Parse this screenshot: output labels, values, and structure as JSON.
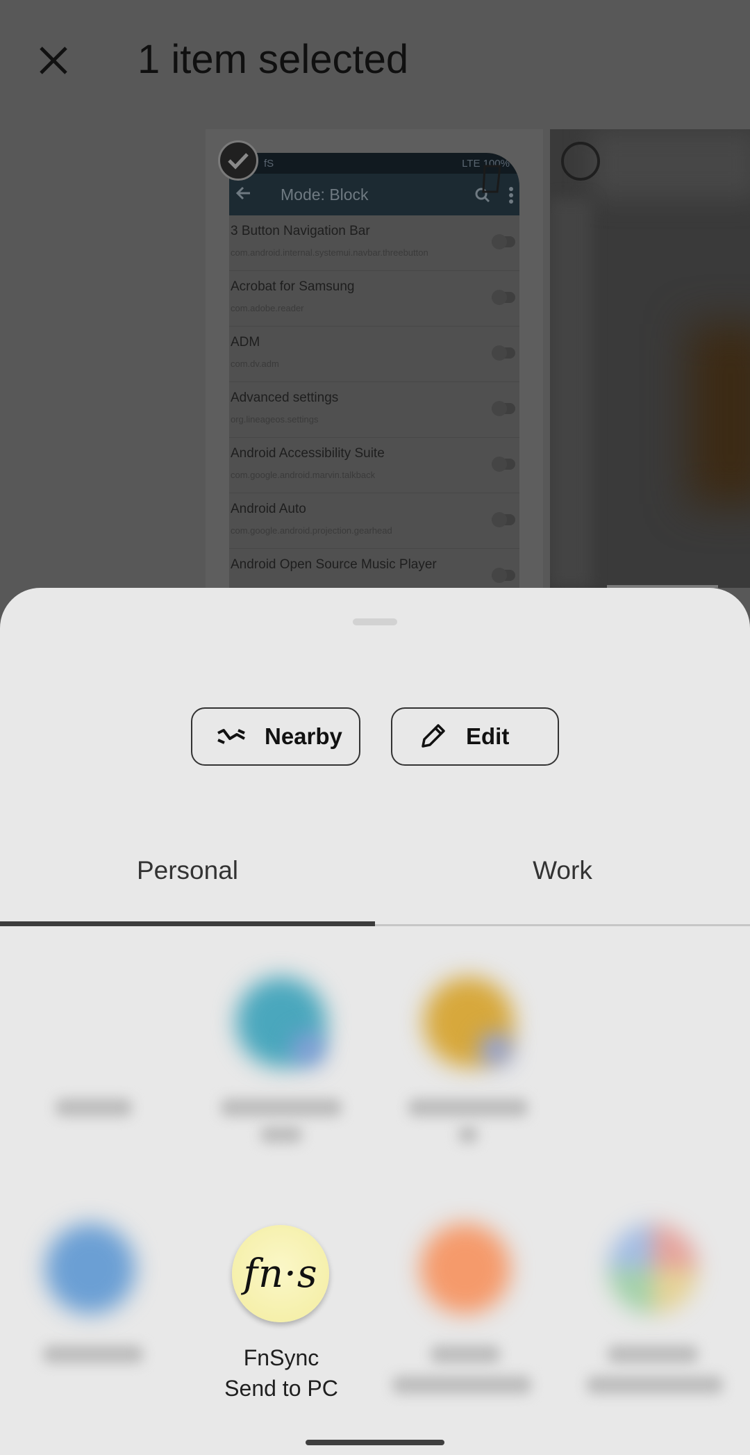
{
  "topbar": {
    "title": "1 item selected",
    "close_icon": "close-icon"
  },
  "preview": {
    "status_left": "fS",
    "status_right": "LTE 100%",
    "appbar_title": "Mode: Block",
    "apps": [
      {
        "name": "3 Button Navigation Bar",
        "package": "com.android.internal.systemui.navbar.threebutton"
      },
      {
        "name": "Acrobat for Samsung",
        "package": "com.adobe.reader"
      },
      {
        "name": "ADM",
        "package": "com.dv.adm"
      },
      {
        "name": "Advanced settings",
        "package": "org.lineageos.settings"
      },
      {
        "name": "Android Accessibility Suite",
        "package": "com.google.android.marvin.talkback"
      },
      {
        "name": "Android Auto",
        "package": "com.google.android.projection.gearhead"
      },
      {
        "name": "Android Open Source Music Player",
        "package": ""
      }
    ]
  },
  "actions": {
    "nearby_label": "Nearby",
    "edit_label": "Edit"
  },
  "tabs": {
    "personal": "Personal",
    "work": "Work"
  },
  "share_target": {
    "logo_text": "fn·s",
    "name": "FnSync",
    "subtitle": "Send to PC"
  },
  "colors": {
    "sheet_bg": "#e8e8e8",
    "scrim": "#585858",
    "logo_bg": "#f3ed9f"
  }
}
